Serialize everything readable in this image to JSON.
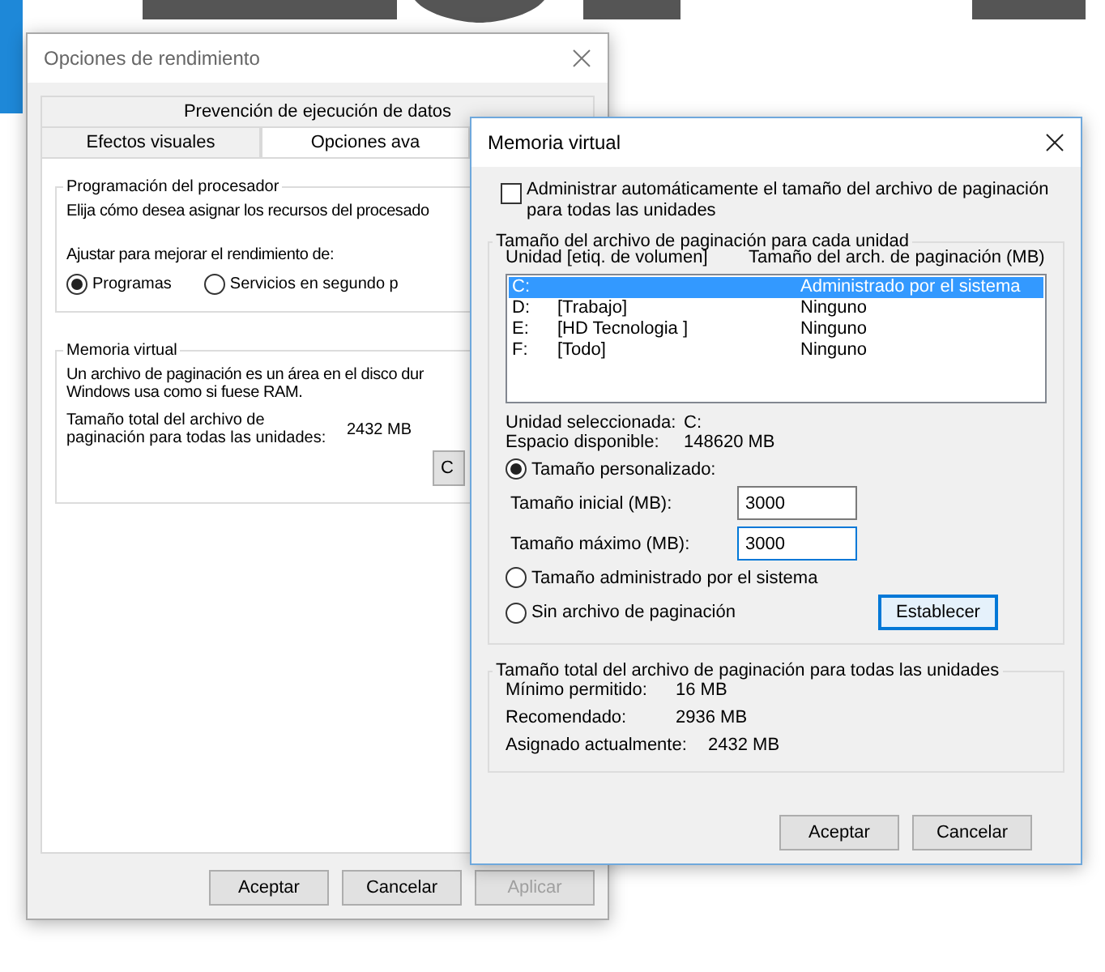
{
  "back_window": {
    "title": "Opciones de rendimiento",
    "tabs_top": [
      {
        "label": "Prevención de ejecución de datos",
        "selected": false
      }
    ],
    "tabs": [
      {
        "label": "Efectos visuales",
        "selected": false
      },
      {
        "label": "Opciones ava",
        "selected": true
      }
    ],
    "processor_group": {
      "title": "Programación del procesador",
      "text": "Elija cómo desea asignar los recursos del procesado",
      "adjust_label": "Ajustar para mejorar el rendimiento de:",
      "options": [
        {
          "label": "Programas",
          "selected": true
        },
        {
          "label": "Servicios en segundo p",
          "selected": false
        }
      ]
    },
    "memory_group": {
      "title": "Memoria virtual",
      "text": "Un archivo de paginación es un área en el disco dur",
      "text2": "Windows usa como si fuese RAM.",
      "total_label": "Tamaño total del archivo de paginación para todas las unidades:",
      "total_value": "2432 MB",
      "change_button": "C"
    },
    "buttons": [
      {
        "label": "Aceptar",
        "disabled": false
      },
      {
        "label": "Cancelar",
        "disabled": false
      },
      {
        "label": "Aplicar",
        "disabled": true
      }
    ]
  },
  "front_window": {
    "title": "Memoria virtual",
    "auto_manage": {
      "label": "Administrar automáticamente el tamaño del archivo de paginación para todas las unidades",
      "checked": false
    },
    "drives_group": {
      "title": "Tamaño del archivo de paginación para cada unidad",
      "columns": [
        "Unidad [etiq. de volumen]",
        "Tamaño del arch. de paginación (MB)"
      ],
      "rows": [
        {
          "drive": "C:",
          "label": "",
          "size": "Administrado por el sistema",
          "selected": true
        },
        {
          "drive": "D:",
          "label": "[Trabajo]",
          "size": "Ninguno",
          "selected": false
        },
        {
          "drive": "E:",
          "label": "[HD Tecnologia ]",
          "size": "Ninguno",
          "selected": false
        },
        {
          "drive": "F:",
          "label": "[Todo]",
          "size": "Ninguno",
          "selected": false
        }
      ],
      "selected_drive_label": "Unidad seleccionada:",
      "selected_drive": "C:",
      "free_space_label": "Espacio disponible:",
      "free_space": "148620 MB",
      "custom_size": {
        "label": "Tamaño personalizado:",
        "selected": true
      },
      "initial_label": "Tamaño inicial (MB):",
      "initial_value": "3000",
      "max_label": "Tamaño máximo (MB):",
      "max_value": "3000",
      "other_options": [
        {
          "label": "Tamaño administrado por el sistema",
          "selected": false
        },
        {
          "label": "Sin archivo de paginación",
          "selected": false
        }
      ],
      "set_button": "Establecer"
    },
    "totals_group": {
      "title": "Tamaño total del archivo de paginación para todas las unidades",
      "rows": [
        {
          "label": "Mínimo permitido:",
          "value": "16 MB"
        },
        {
          "label": "Recomendado:",
          "value": "2936 MB"
        },
        {
          "label": "Asignado actualmente:",
          "value": "2432 MB"
        }
      ]
    },
    "buttons": [
      {
        "label": "Aceptar"
      },
      {
        "label": "Cancelar"
      }
    ]
  }
}
